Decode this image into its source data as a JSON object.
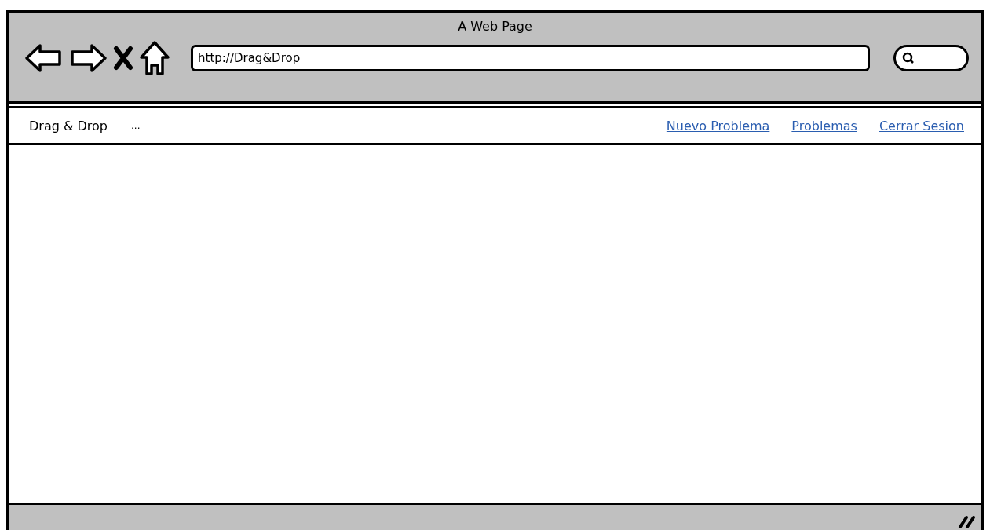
{
  "window": {
    "title": "A Web Page"
  },
  "toolbar": {
    "address": "http://Drag&Drop"
  },
  "nav": {
    "brand": "Drag & Drop",
    "extra": "...",
    "links": [
      {
        "label": "Nuevo Problema"
      },
      {
        "label": "Problemas"
      },
      {
        "label": "Cerrar Sesion"
      }
    ]
  }
}
